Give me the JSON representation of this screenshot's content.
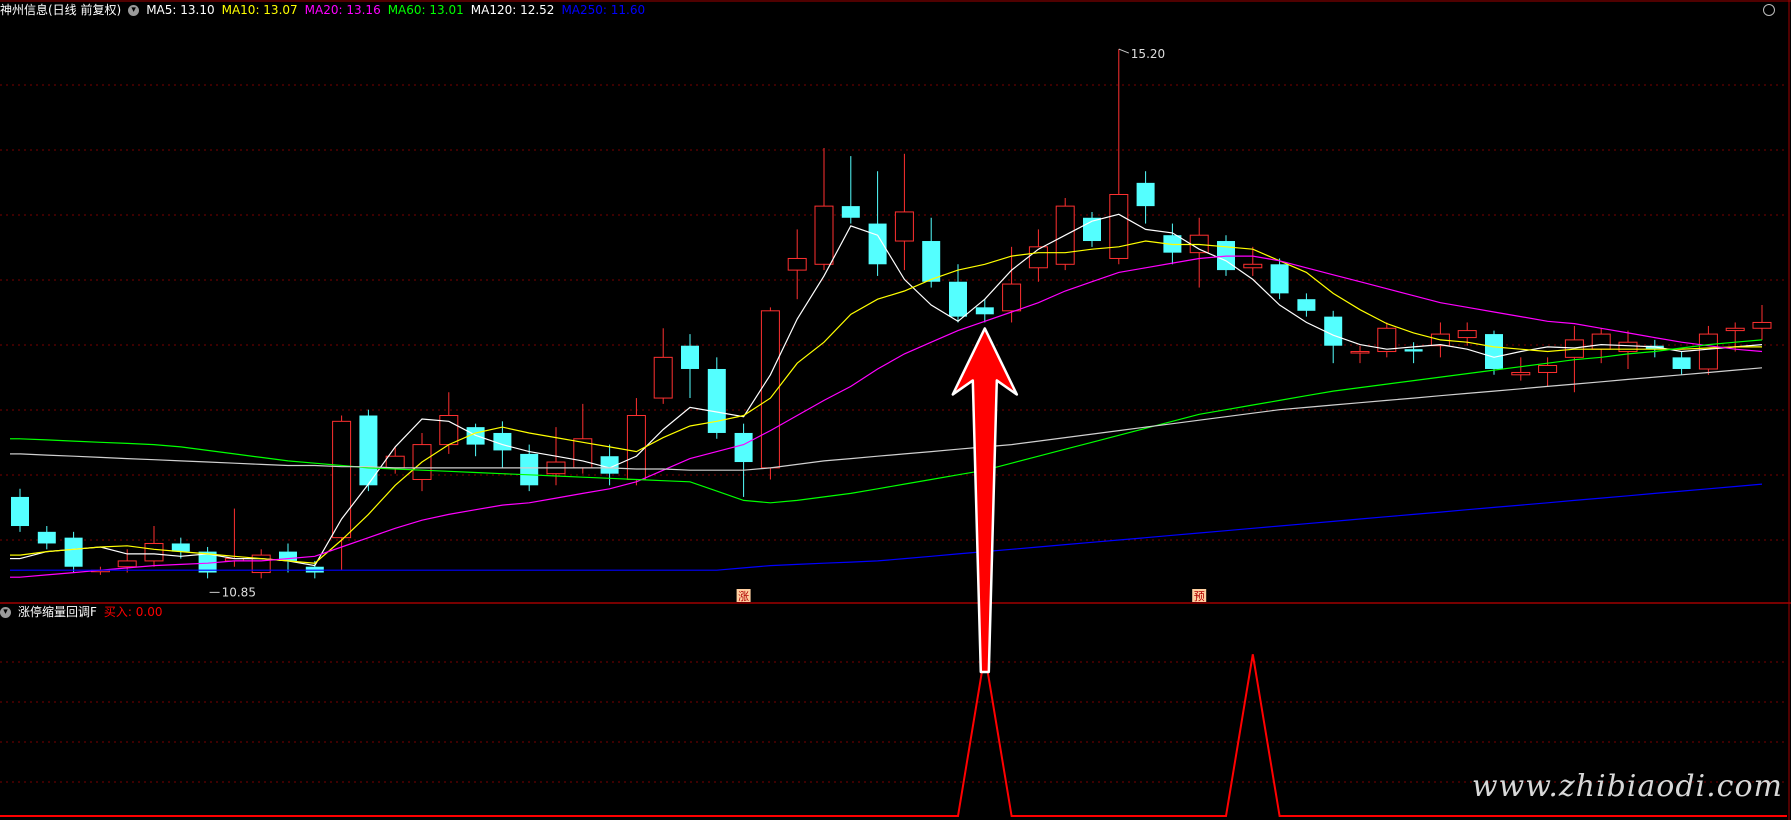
{
  "header": {
    "stock": "神州信息(日线 前复权)",
    "ma": [
      {
        "label": "MA5: 13.10",
        "color": "#ffffff"
      },
      {
        "label": "MA10: 13.07",
        "color": "#ffff00"
      },
      {
        "label": "MA20: 13.16",
        "color": "#ff00ff"
      },
      {
        "label": "MA60: 13.01",
        "color": "#00ff00"
      },
      {
        "label": "MA120: 12.52",
        "color": "#ffffff"
      },
      {
        "label": "MA250: 11.60",
        "color": "#0000ff"
      }
    ]
  },
  "indicator": {
    "name": "涨停缩量回调F",
    "value_label": "买入: 0.00",
    "value_color": "#ff0000"
  },
  "watermark": "www.zhibiaodi.com",
  "colors": {
    "up": "#ff3030",
    "down": "#54ffff",
    "grid": "#7a0000",
    "divider": "#a00000",
    "arrow": "#ff0000"
  },
  "chart_data": [
    {
      "type": "candlestick",
      "high_label": "15.20",
      "low_label": "10.85",
      "signals": [
        {
          "index": 27,
          "label": "涨"
        },
        {
          "index": 44,
          "label": "预"
        }
      ],
      "arrow_target_index": 36,
      "ylim": [
        10.55,
        15.45
      ],
      "candles": [
        [
          11.35,
          11.1,
          11.42,
          11.05
        ],
        [
          11.05,
          10.95,
          11.1,
          10.9
        ],
        [
          11.0,
          10.75,
          11.05,
          10.7
        ],
        [
          10.72,
          10.72,
          10.75,
          10.68
        ],
        [
          10.75,
          10.8,
          10.9,
          10.7
        ],
        [
          10.8,
          10.95,
          11.1,
          10.75
        ],
        [
          10.95,
          10.88,
          11.0,
          10.82
        ],
        [
          10.88,
          10.7,
          10.92,
          10.65
        ],
        [
          10.8,
          10.82,
          11.25,
          10.75
        ],
        [
          10.7,
          10.85,
          10.9,
          10.65
        ],
        [
          10.88,
          10.8,
          10.95,
          10.7
        ],
        [
          10.75,
          10.7,
          10.8,
          10.65
        ],
        [
          11.0,
          12.0,
          12.05,
          10.72
        ],
        [
          12.05,
          11.45,
          12.1,
          11.4
        ],
        [
          11.6,
          11.7,
          11.78,
          11.55
        ],
        [
          11.5,
          11.8,
          11.9,
          11.4
        ],
        [
          11.8,
          12.05,
          12.25,
          11.72
        ],
        [
          11.95,
          11.8,
          11.98,
          11.7
        ],
        [
          11.9,
          11.75,
          12.0,
          11.6
        ],
        [
          11.72,
          11.45,
          11.8,
          11.4
        ],
        [
          11.55,
          11.65,
          11.95,
          11.45
        ],
        [
          11.6,
          11.85,
          12.15,
          11.55
        ],
        [
          11.7,
          11.55,
          11.8,
          11.45
        ],
        [
          11.5,
          12.05,
          12.2,
          11.45
        ],
        [
          12.2,
          12.55,
          12.8,
          12.15
        ],
        [
          12.65,
          12.45,
          12.75,
          12.2
        ],
        [
          12.45,
          11.9,
          12.55,
          11.85
        ],
        [
          11.9,
          11.65,
          11.98,
          11.35
        ],
        [
          11.6,
          12.95,
          12.98,
          11.5
        ],
        [
          13.3,
          13.4,
          13.65,
          13.05
        ],
        [
          13.35,
          13.85,
          14.35,
          13.3
        ],
        [
          13.85,
          13.75,
          14.28,
          13.7
        ],
        [
          13.7,
          13.35,
          14.15,
          13.25
        ],
        [
          13.55,
          13.8,
          14.3,
          13.3
        ],
        [
          13.55,
          13.2,
          13.75,
          13.15
        ],
        [
          13.2,
          12.9,
          13.35,
          12.85
        ],
        [
          12.98,
          12.92,
          13.05,
          12.85
        ],
        [
          12.95,
          13.18,
          13.5,
          12.85
        ],
        [
          13.32,
          13.5,
          13.65,
          13.2
        ],
        [
          13.35,
          13.85,
          13.92,
          13.3
        ],
        [
          13.75,
          13.55,
          13.8,
          13.5
        ],
        [
          13.4,
          13.95,
          15.2,
          13.35
        ],
        [
          14.05,
          13.85,
          14.15,
          13.7
        ],
        [
          13.6,
          13.45,
          13.7,
          13.35
        ],
        [
          13.45,
          13.6,
          13.75,
          13.15
        ],
        [
          13.55,
          13.3,
          13.6,
          13.25
        ],
        [
          13.32,
          13.35,
          13.5,
          13.25
        ],
        [
          13.35,
          13.1,
          13.4,
          13.05
        ],
        [
          13.05,
          12.95,
          13.1,
          12.9
        ],
        [
          12.9,
          12.65,
          12.95,
          12.5
        ],
        [
          12.6,
          12.6,
          12.65,
          12.5
        ],
        [
          12.6,
          12.8,
          12.85,
          12.55
        ],
        [
          12.62,
          12.6,
          12.68,
          12.5
        ],
        [
          12.65,
          12.75,
          12.85,
          12.55
        ],
        [
          12.72,
          12.78,
          12.85,
          12.65
        ],
        [
          12.75,
          12.45,
          12.78,
          12.4
        ],
        [
          12.4,
          12.42,
          12.55,
          12.35
        ],
        [
          12.42,
          12.48,
          12.55,
          12.3
        ],
        [
          12.55,
          12.7,
          12.82,
          12.25
        ],
        [
          12.62,
          12.75,
          12.8,
          12.5
        ],
        [
          12.6,
          12.68,
          12.78,
          12.45
        ],
        [
          12.65,
          12.62,
          12.7,
          12.55
        ],
        [
          12.55,
          12.45,
          12.6,
          12.4
        ],
        [
          12.45,
          12.75,
          12.82,
          12.4
        ],
        [
          12.78,
          12.8,
          12.85,
          12.6
        ],
        [
          12.8,
          12.85,
          13.0,
          12.7
        ]
      ],
      "ma": [
        {
          "name": "MA5",
          "color": "#ffffff",
          "start": 0,
          "values": [
            10.82,
            10.88,
            10.9,
            10.92,
            10.86,
            10.86,
            10.84,
            10.86,
            10.82,
            10.82,
            10.8,
            10.76,
            11.16,
            11.46,
            11.78,
            12.02,
            12.0,
            11.88,
            11.8,
            11.74,
            11.7,
            11.66,
            11.6,
            11.7,
            11.93,
            12.12,
            12.08,
            12.04,
            12.4,
            12.88,
            13.25,
            13.68,
            13.6,
            13.22,
            13.0,
            12.86,
            13.05,
            13.3,
            13.48,
            13.6,
            13.72,
            13.78,
            13.65,
            13.62,
            13.48,
            13.38,
            13.22,
            13.0,
            12.85,
            12.74,
            12.66,
            12.62,
            12.64,
            12.66,
            12.62,
            12.55,
            12.6,
            12.64,
            12.63,
            12.66,
            12.65,
            12.64,
            12.6,
            12.62,
            12.64,
            12.66
          ]
        },
        {
          "name": "MA10",
          "color": "#ffff00",
          "start": 0,
          "values": [
            10.85,
            10.88,
            10.9,
            10.92,
            10.93,
            10.9,
            10.88,
            10.86,
            10.84,
            10.82,
            10.8,
            10.78,
            10.98,
            11.2,
            11.45,
            11.65,
            11.8,
            11.9,
            11.95,
            11.9,
            11.86,
            11.82,
            11.78,
            11.74,
            11.86,
            11.96,
            12.0,
            12.05,
            12.2,
            12.5,
            12.68,
            12.92,
            13.05,
            13.12,
            13.22,
            13.3,
            13.35,
            13.42,
            13.45,
            13.45,
            13.48,
            13.5,
            13.55,
            13.52,
            13.52,
            13.5,
            13.48,
            13.38,
            13.28,
            13.1,
            12.96,
            12.84,
            12.76,
            12.7,
            12.68,
            12.64,
            12.62,
            12.6,
            12.62,
            12.62,
            12.62,
            12.62,
            12.62,
            12.63,
            12.64,
            12.64
          ]
        },
        {
          "name": "MA20",
          "color": "#ff00ff",
          "start": 0,
          "values": [
            10.66,
            10.68,
            10.7,
            10.72,
            10.74,
            10.76,
            10.77,
            10.78,
            10.8,
            10.8,
            10.82,
            10.84,
            10.92,
            11.0,
            11.08,
            11.15,
            11.2,
            11.24,
            11.28,
            11.3,
            11.34,
            11.38,
            11.42,
            11.48,
            11.58,
            11.68,
            11.74,
            11.8,
            11.92,
            12.05,
            12.18,
            12.3,
            12.45,
            12.58,
            12.68,
            12.78,
            12.86,
            12.94,
            13.02,
            13.12,
            13.2,
            13.28,
            13.32,
            13.36,
            13.4,
            13.42,
            13.42,
            13.38,
            13.32,
            13.26,
            13.2,
            13.14,
            13.08,
            13.02,
            12.98,
            12.94,
            12.9,
            12.86,
            12.84,
            12.8,
            12.76,
            12.72,
            12.68,
            12.65,
            12.62,
            12.6
          ]
        },
        {
          "name": "MA60",
          "color": "#00ff00",
          "start": 0,
          "values": [
            11.85,
            11.84,
            11.83,
            11.82,
            11.81,
            11.8,
            11.78,
            11.75,
            11.72,
            11.69,
            11.66,
            11.64,
            11.62,
            11.6,
            11.59,
            11.58,
            11.57,
            11.56,
            11.55,
            11.54,
            11.53,
            11.52,
            11.51,
            11.5,
            11.49,
            11.48,
            11.4,
            11.32,
            11.3,
            11.32,
            11.35,
            11.38,
            11.42,
            11.46,
            11.5,
            11.54,
            11.58,
            11.64,
            11.7,
            11.76,
            11.82,
            11.88,
            11.94,
            12.0,
            12.06,
            12.1,
            12.14,
            12.18,
            12.22,
            12.26,
            12.29,
            12.32,
            12.35,
            12.38,
            12.41,
            12.44,
            12.47,
            12.5,
            12.53,
            12.55,
            12.58,
            12.6,
            12.63,
            12.66,
            12.68,
            12.7
          ]
        },
        {
          "name": "MA120",
          "color": "#d0d0d0",
          "start": 0,
          "values": [
            11.72,
            11.71,
            11.7,
            11.69,
            11.68,
            11.67,
            11.66,
            11.65,
            11.64,
            11.63,
            11.62,
            11.62,
            11.61,
            11.61,
            11.6,
            11.6,
            11.6,
            11.6,
            11.6,
            11.6,
            11.6,
            11.6,
            11.6,
            11.59,
            11.59,
            11.58,
            11.58,
            11.58,
            11.6,
            11.63,
            11.66,
            11.68,
            11.7,
            11.72,
            11.74,
            11.76,
            11.78,
            11.8,
            11.83,
            11.86,
            11.89,
            11.92,
            11.95,
            11.98,
            12.01,
            12.04,
            12.07,
            12.1,
            12.12,
            12.14,
            12.16,
            12.18,
            12.2,
            12.22,
            12.24,
            12.26,
            12.28,
            12.3,
            12.32,
            12.34,
            12.36,
            12.38,
            12.4,
            12.42,
            12.44,
            12.46
          ]
        },
        {
          "name": "MA250",
          "color": "#0000ff",
          "start": 0,
          "values": [
            10.72,
            10.72,
            10.72,
            10.72,
            10.72,
            10.72,
            10.72,
            10.72,
            10.72,
            10.72,
            10.72,
            10.72,
            10.72,
            10.72,
            10.72,
            10.72,
            10.72,
            10.72,
            10.72,
            10.72,
            10.72,
            10.72,
            10.72,
            10.72,
            10.72,
            10.72,
            10.72,
            10.74,
            10.76,
            10.77,
            10.78,
            10.79,
            10.8,
            10.82,
            10.84,
            10.86,
            10.88,
            10.9,
            10.92,
            10.94,
            10.96,
            10.98,
            11.0,
            11.02,
            11.04,
            11.06,
            11.08,
            11.1,
            11.12,
            11.14,
            11.16,
            11.18,
            11.2,
            11.22,
            11.24,
            11.26,
            11.28,
            11.3,
            11.32,
            11.34,
            11.36,
            11.38,
            11.4,
            11.42,
            11.44,
            11.46
          ]
        }
      ]
    },
    {
      "type": "line",
      "series": [
        {
          "name": "买入",
          "color": "#ff0000",
          "values": [
            0,
            0,
            0,
            0,
            0,
            0,
            0,
            0,
            0,
            0,
            0,
            0,
            0,
            0,
            0,
            0,
            0,
            0,
            0,
            0,
            0,
            0,
            0,
            0,
            0,
            0,
            0,
            0,
            0,
            0,
            0,
            0,
            0,
            0,
            0,
            0,
            1,
            0,
            0,
            0,
            0,
            0,
            0,
            0,
            0,
            0,
            1,
            0,
            0,
            0,
            0,
            0,
            0,
            0,
            0,
            0,
            0,
            0,
            0,
            0,
            0,
            0,
            0,
            0,
            0,
            0
          ]
        }
      ],
      "ylim": [
        0,
        1.2
      ]
    }
  ]
}
